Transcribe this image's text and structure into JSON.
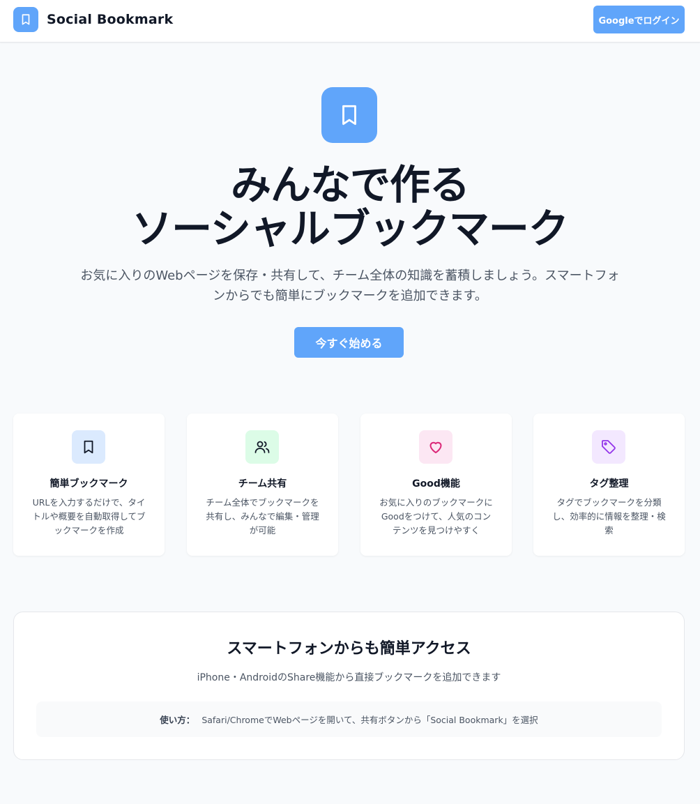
{
  "header": {
    "brand": "Social Bookmark",
    "login_label": "Googleでログイン"
  },
  "hero": {
    "title_line1": "みんなで作る",
    "title_line2": "ソーシャルブックマーク",
    "subtitle": "お気に入りのWebページを保存・共有して、チーム全体の知識を蓄積しましょう。スマートフォンからでも簡単にブックマークを追加できます。",
    "cta_label": "今すぐ始める"
  },
  "features": [
    {
      "icon": "bookmark-icon",
      "title": "簡単ブックマーク",
      "desc": "URLを入力するだけで、タイトルや概要を自動取得してブックマークを作成",
      "bg": "#dbeafe",
      "color": "#1e3a8a"
    },
    {
      "icon": "users-icon",
      "title": "チーム共有",
      "desc": "チーム全体でブックマークを共有し、みんなで編集・管理が可能",
      "bg": "#dcfce7",
      "color": "#14532d"
    },
    {
      "icon": "heart-icon",
      "title": "Good機能",
      "desc": "お気に入りのブックマークにGoodをつけて、人気のコンテンツを見つけやすく",
      "bg": "#fce7f3",
      "color": "#db2777"
    },
    {
      "icon": "tag-icon",
      "title": "タグ整理",
      "desc": "タグでブックマークを分類し、効率的に情報を整理・検索",
      "bg": "#f3e8ff",
      "color": "#9333ea"
    }
  ],
  "mobile": {
    "title": "スマートフォンからも簡単アクセス",
    "subtitle": "iPhone・AndroidのShare機能から直接ブックマークを追加できます",
    "howto_label": "使い方：",
    "howto_text": "Safari/ChromeでWebページを開いて、共有ボタンから「Social Bookmark」を選択"
  },
  "colors": {
    "accent": "#60a5fa",
    "background": "#f8fafc"
  }
}
